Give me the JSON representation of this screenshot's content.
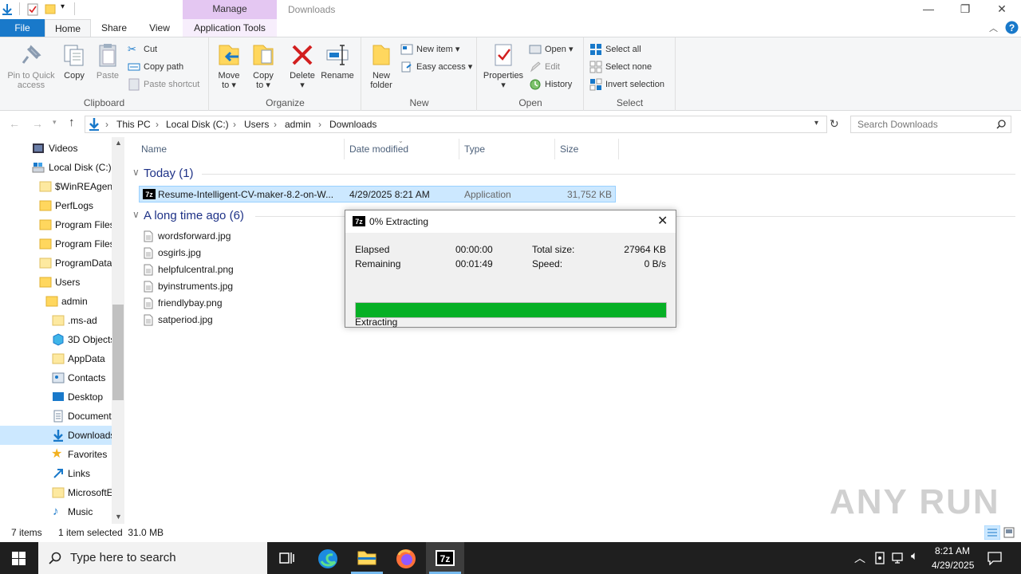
{
  "titlebar": {
    "manage": "Manage",
    "title": "Downloads",
    "minimize": "—",
    "maximize": "❐",
    "close": "✕"
  },
  "tabs": {
    "file": "File",
    "home": "Home",
    "share": "Share",
    "view": "View",
    "app_tools": "Application Tools"
  },
  "ribbon": {
    "clipboard": {
      "label": "Clipboard",
      "pin_line1": "Pin to Quick",
      "pin_line2": "access",
      "copy": "Copy",
      "paste": "Paste",
      "cut": "Cut",
      "copy_path": "Copy path",
      "paste_shortcut": "Paste shortcut"
    },
    "organize": {
      "label": "Organize",
      "move_line1": "Move",
      "move_line2": "to",
      "copy_line1": "Copy",
      "copy_line2": "to",
      "delete": "Delete",
      "rename": "Rename"
    },
    "new": {
      "label": "New",
      "folder_line1": "New",
      "folder_line2": "folder",
      "new_item": "New item",
      "easy_access": "Easy access"
    },
    "open": {
      "label": "Open",
      "properties": "Properties",
      "open": "Open",
      "edit": "Edit",
      "history": "History"
    },
    "select": {
      "label": "Select",
      "select_all": "Select all",
      "select_none": "Select none",
      "invert": "Invert selection"
    }
  },
  "address": {
    "crumbs": [
      "This PC",
      "Local Disk (C:)",
      "Users",
      "admin",
      "Downloads"
    ],
    "search_placeholder": "Search Downloads"
  },
  "nav": {
    "items": [
      "Videos",
      "Local Disk (C:)",
      "$WinREAgent",
      "PerfLogs",
      "Program Files",
      "Program Files",
      "ProgramData",
      "Users",
      "admin",
      ".ms-ad",
      "3D Objects",
      "AppData",
      "Contacts",
      "Desktop",
      "Documents",
      "Downloads",
      "Favorites",
      "Links",
      "MicrosoftEdge",
      "Music"
    ]
  },
  "filelist": {
    "columns": {
      "name": "Name",
      "date": "Date modified",
      "type": "Type",
      "size": "Size"
    },
    "group_today": "Today (1)",
    "group_old": "A long time ago (6)",
    "selected_file": {
      "name": "Resume-Intelligent-CV-maker-8.2-on-W...",
      "date": "4/29/2025 8:21 AM",
      "type": "Application",
      "size": "31,752 KB"
    },
    "old_files": [
      "wordsforward.jpg",
      "osgirls.jpg",
      "helpfulcentral.png",
      "byinstruments.jpg",
      "friendlybay.png",
      "satperiod.jpg"
    ]
  },
  "dialog": {
    "title": "0% Extracting",
    "elapsed_label": "Elapsed",
    "elapsed_value": "00:00:00",
    "remaining_label": "Remaining",
    "remaining_value": "00:01:49",
    "total_label": "Total size:",
    "total_value": "27964 KB",
    "speed_label": "Speed:",
    "speed_value": "0 B/s",
    "progress_fraction": 1.0,
    "status": "Extracting",
    "progress_color": "#06b025"
  },
  "status": {
    "items": "7 items",
    "selected": "1 item selected  31.0 MB"
  },
  "taskbar": {
    "search_placeholder": "Type here to search",
    "time": "8:21 AM",
    "date": "4/29/2025"
  },
  "watermark": "ANY RUN",
  "colors": {
    "accent": "#1979ca",
    "selection": "#cce8ff",
    "manage": "#e4c7f2"
  }
}
